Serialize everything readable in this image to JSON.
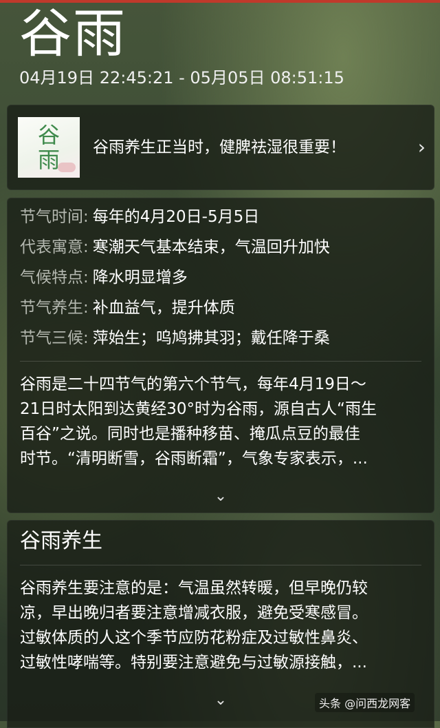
{
  "header": {
    "title": "谷雨",
    "period": "04月19日 22:45:21 - 05月05日 08:51:15"
  },
  "banner": {
    "thumb_top": "谷",
    "thumb_bottom": "雨",
    "text": "谷雨养生正当时，健脾祛湿很重要！",
    "chevron": "›"
  },
  "info": {
    "rows": [
      {
        "key": "节气时间:",
        "value": "每年的4月20日-5月5日"
      },
      {
        "key": "代表寓意:",
        "value": "寒潮天气基本结束，气温回升加快"
      },
      {
        "key": "气候特点:",
        "value": "降水明显增多"
      },
      {
        "key": "节气养生:",
        "value": "补血益气，提升体质"
      },
      {
        "key": "节气三候:",
        "value": "萍始生；呜鸠拂其羽；戴任降于桑"
      }
    ],
    "description": [
      "谷雨是二十四节气的第六个节气，每年4月19日～",
      "21日时太阳到达黄经30°时为谷雨，源自古人“雨生",
      "百谷”之说。同时也是播种移苗、掩瓜点豆的最佳",
      "时节。“清明断雪，谷雨断霜”，气象专家表示，..."
    ],
    "expand": "⌄"
  },
  "health": {
    "title": "谷雨养生",
    "lines": [
      "谷雨养生要注意的是：气温虽然转暖，但早晚仍较",
      "凉，早出晚归者要注意增减衣服，避免受寒感冒。",
      "过敏体质的人这个季节应防花粉症及过敏性鼻炎、",
      "过敏性哮喘等。特别要注意避免与过敏源接触，..."
    ],
    "expand": "⌄"
  },
  "watermark": "头条 @问西龙网客"
}
